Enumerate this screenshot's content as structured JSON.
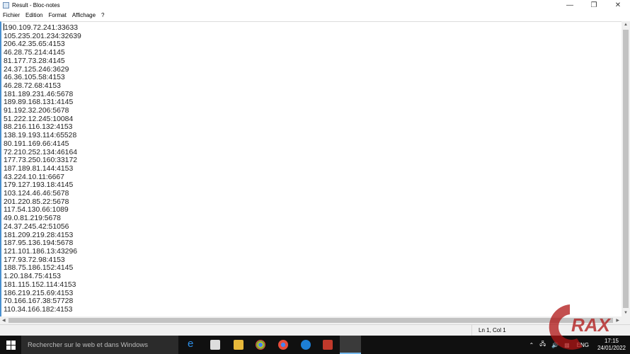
{
  "window": {
    "title": "Result - Bloc-notes",
    "minimize_icon": "minimize-icon",
    "maximize_icon": "restore-icon",
    "close_icon": "close-icon"
  },
  "menu": [
    "Fichier",
    "Edition",
    "Format",
    "Affichage",
    "?"
  ],
  "editor": {
    "lines": [
      "190.109.72.241:33633",
      "105.235.201.234:32639",
      "206.42.35.65:4153",
      "46.28.75.214:4145",
      "81.177.73.28:4145",
      "24.37.125.246:3629",
      "46.36.105.58:4153",
      "46.28.72.68:4153",
      "181.189.231.46:5678",
      "189.89.168.131:4145",
      "91.192.32.206:5678",
      "51.222.12.245:10084",
      "88.216.116.132:4153",
      "138.19.193.114:65528",
      "80.191.169.66:4145",
      "72.210.252.134:46164",
      "177.73.250.160:33172",
      "187.189.81.144:4153",
      "43.224.10.11:6667",
      "179.127.193.18:4145",
      "103.124.46.46:5678",
      "201.220.85.22:5678",
      "117.54.130.66:1089",
      "49.0.81.219:5678",
      "24.37.245.42:51056",
      "181.209.219.28:4153",
      "187.95.136.194:5678",
      "121.101.186.13:43296",
      "177.93.72.98:4153",
      "188.75.186.152:4145",
      "1.20.184.75:4153",
      "181.115.152.114:4153",
      "186.219.215.69:4153",
      "70.166.167.38:57728",
      "110.34.166.182:4153"
    ]
  },
  "status": {
    "position": "Ln 1, Col 1"
  },
  "taskbar": {
    "search_placeholder": "Rechercher sur le web et dans Windows",
    "language": "ENG",
    "time": "17:15",
    "date": "24/01/2022"
  },
  "watermark": {
    "text": "RAX"
  },
  "colors": {
    "accent": "#4a90d0",
    "taskbar": "#101010",
    "watermark": "#b01515"
  }
}
